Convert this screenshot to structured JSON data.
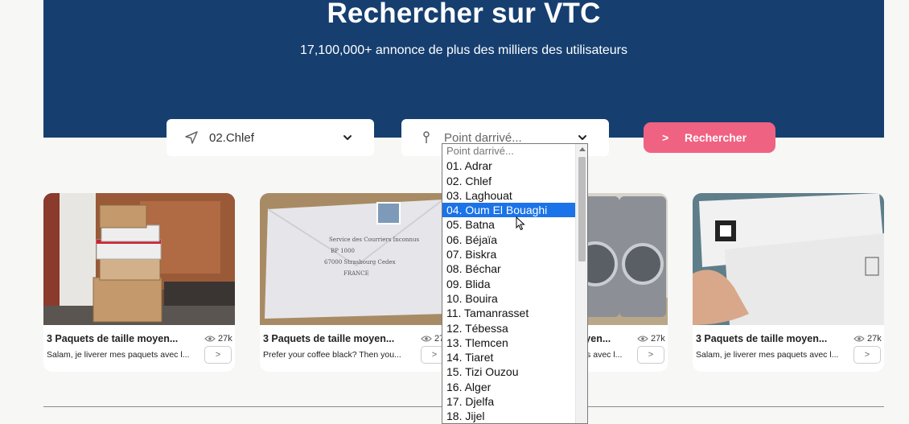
{
  "hero": {
    "title": "Rechercher sur VTC",
    "subtitle": "17,100,000+ annonce de plus des milliers des utilisateurs",
    "background_color": "#163f70"
  },
  "search": {
    "departure": {
      "icon": "navigation-arrow-icon",
      "value": "02.Chlef"
    },
    "arrival": {
      "icon": "map-pin-icon",
      "value": "Point darrivé..."
    },
    "button_label": "Rechercher",
    "button_color": "#f06282"
  },
  "cards": [
    {
      "title": "3 Paquets de taille moyen...",
      "views": "27k",
      "description": "Salam, je liverer mes paquets avec l...",
      "image": "packages-at-door"
    },
    {
      "title": "3 Paquets de taille moyen...",
      "views": "27k",
      "description": "Prefer your coffee black? Then you...",
      "image": "handwritten-envelope"
    },
    {
      "title": "3 Paquets de taille moyen...",
      "views": "27k",
      "description": "Salam, je liverer mes paquets avec l...",
      "image": "washing-machines"
    },
    {
      "title": "3 Paquets de taille moyen...",
      "views": "27k",
      "description": "Salam, je liverer mes paquets avec l...",
      "image": "priority-envelopes"
    }
  ],
  "dropdown": {
    "selected_index": 4,
    "options": [
      "Point darrivé...",
      "01. Adrar",
      "02. Chlef",
      "03. Laghouat",
      "04. Oum El Bouaghi",
      "05. Batna",
      "06. Béjaïa",
      "07. Biskra",
      "08. Béchar",
      "09. Blida",
      "10. Bouira",
      "11. Tamanrasset",
      "12. Tébessa",
      "13. Tlemcen",
      "14. Tiaret",
      "15. Tizi Ouzou",
      "16. Alger",
      "17. Djelfa",
      "18. Jijel"
    ],
    "highlight_color": "#1a73e8"
  }
}
